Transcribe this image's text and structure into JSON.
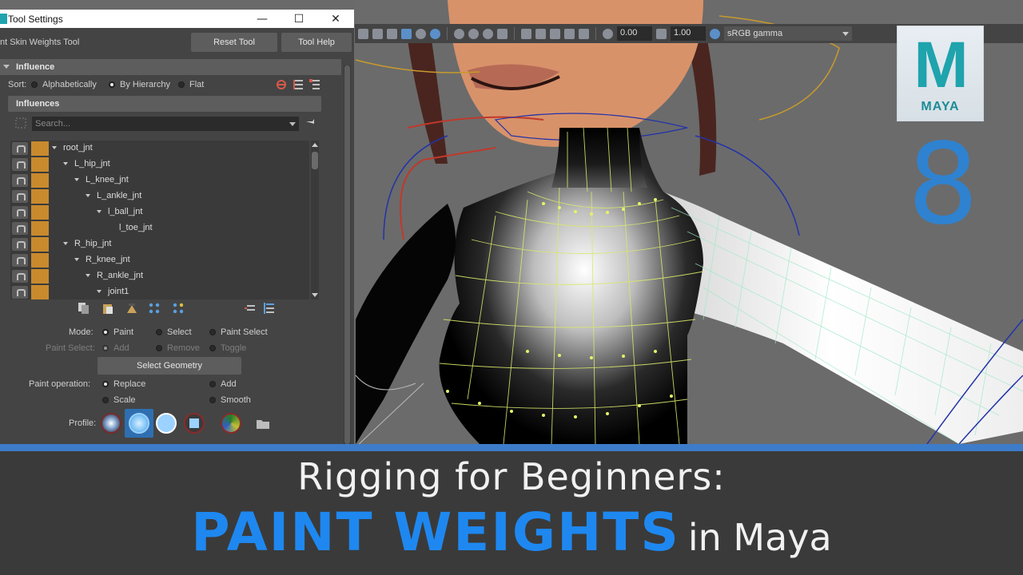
{
  "window": {
    "title": "Tool Settings",
    "tool_name": "nt Skin Weights Tool",
    "reset_button": "Reset Tool",
    "help_button": "Tool Help"
  },
  "influence_section": {
    "header": "Influence",
    "sort_label": "Sort:",
    "sort_options": [
      "Alphabetically",
      "By Hierarchy",
      "Flat"
    ],
    "sort_selected": "By Hierarchy",
    "subheader": "Influences",
    "search_placeholder": "Search...",
    "joints": [
      {
        "name": "root_jnt",
        "depth": 0
      },
      {
        "name": "L_hip_jnt",
        "depth": 1
      },
      {
        "name": "L_knee_jnt",
        "depth": 2
      },
      {
        "name": "L_ankle_jnt",
        "depth": 3
      },
      {
        "name": "l_ball_jnt",
        "depth": 4
      },
      {
        "name": "l_toe_jnt",
        "depth": 5
      },
      {
        "name": "R_hip_jnt",
        "depth": 1
      },
      {
        "name": "R_knee_jnt",
        "depth": 2
      },
      {
        "name": "R_ankle_jnt",
        "depth": 3
      },
      {
        "name": "joint1",
        "depth": 4
      }
    ],
    "joint_color": "#c98a2e"
  },
  "paint": {
    "mode_label": "Mode:",
    "mode_options": [
      "Paint",
      "Select",
      "Paint Select"
    ],
    "mode_selected": "Paint",
    "paint_select_label": "Paint Select:",
    "paint_select_options": [
      "Add",
      "Remove",
      "Toggle"
    ],
    "select_geometry_button": "Select Geometry",
    "operation_label": "Paint operation:",
    "operation_options": [
      "Replace",
      "Add",
      "Scale",
      "Smooth"
    ],
    "operation_selected": "Replace",
    "profile_label": "Profile:"
  },
  "viewport": {
    "exposure": "0.00",
    "gamma": "1.00",
    "color_space": "sRGB gamma"
  },
  "branding": {
    "logo_letter": "M",
    "logo_word": "MAYA",
    "episode_number": "8",
    "accent_color": "#1e88f0"
  },
  "banner": {
    "subtitle": "Rigging for Beginners:",
    "title_main": "PAINT WEIGHTS",
    "title_suffix": "in Maya"
  }
}
